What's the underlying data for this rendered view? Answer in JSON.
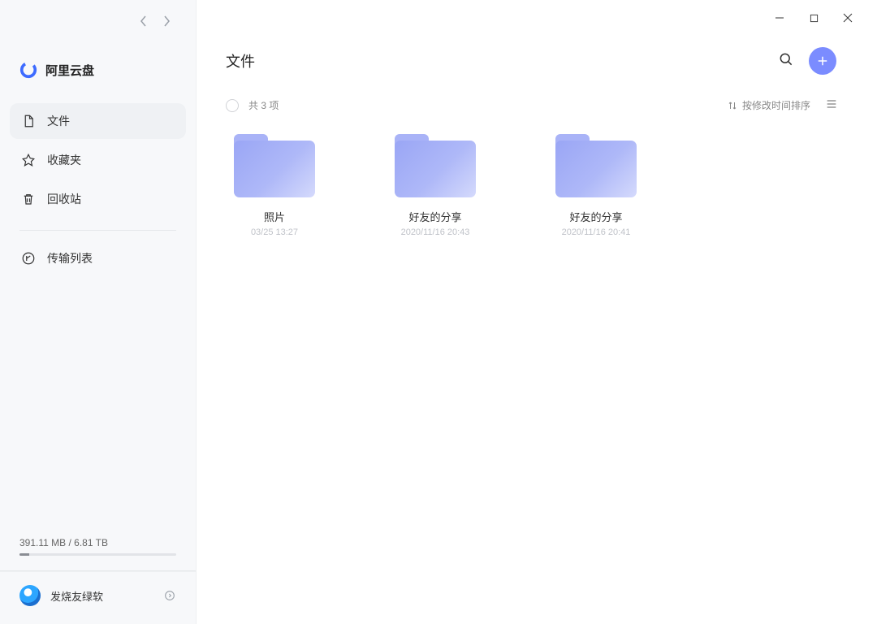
{
  "brand": {
    "name": "阿里云盘"
  },
  "sidebar": {
    "items": [
      {
        "label": "文件",
        "active": true
      },
      {
        "label": "收藏夹",
        "active": false
      },
      {
        "label": "回收站",
        "active": false
      }
    ],
    "transfer_label": "传输列表"
  },
  "storage": {
    "text": "391.11 MB / 6.81 TB"
  },
  "user": {
    "name": "发烧友绿软"
  },
  "page": {
    "title": "文件"
  },
  "toolbar": {
    "count": "共 3 项",
    "sort_label": "按修改时间排序"
  },
  "folders": [
    {
      "name": "照片",
      "date": "03/25 13:27"
    },
    {
      "name": "好友的分享",
      "date": "2020/11/16 20:43"
    },
    {
      "name": "好友的分享",
      "date": "2020/11/16 20:41"
    }
  ]
}
